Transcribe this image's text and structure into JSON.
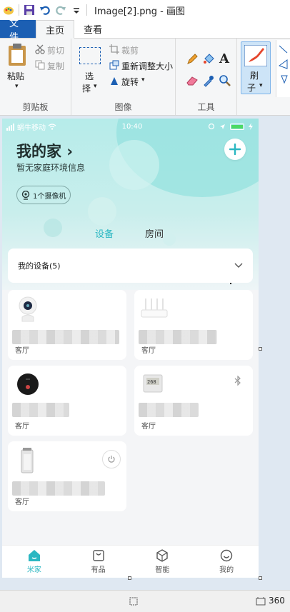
{
  "window": {
    "title": "Image[2].png - 画图"
  },
  "ribbon_tabs": {
    "file": "文件",
    "home": "主页",
    "view": "查看"
  },
  "ribbon": {
    "clipboard": {
      "paste": "粘贴",
      "cut": "剪切",
      "copy": "复制",
      "label": "剪贴板"
    },
    "image": {
      "select_1": "选",
      "select_2": "择",
      "crop": "裁剪",
      "resize": "重新调整大小",
      "rotate": "旋转",
      "label": "图像"
    },
    "tools": {
      "label": "工具"
    },
    "brushes": {
      "label_1": "刷",
      "label_2": "子"
    }
  },
  "phone": {
    "status": {
      "carrier": "蜗牛移动",
      "time": "10:40"
    },
    "home_title": "我的家",
    "home_title_arrow": "›",
    "home_subtitle": "暂无家庭环境信息",
    "camera_chip": "1个摄像机",
    "segments": {
      "devices": "设备",
      "rooms": "房间"
    },
    "devices_header": "我的设备(5)",
    "devices": [
      {
        "room": "客厅",
        "icon": "camera-icon"
      },
      {
        "room": "客厅",
        "icon": "router-icon"
      },
      {
        "room": "客厅",
        "icon": "door-lock-icon"
      },
      {
        "room": "客厅",
        "icon": "thermometer-display-icon",
        "extra_icon": "bluetooth-icon"
      },
      {
        "room": "客厅",
        "icon": "air-purifier-icon",
        "extra_icon": "power-icon"
      }
    ],
    "tabbar": [
      {
        "label": "米家",
        "active": true
      },
      {
        "label": "有品",
        "active": false
      },
      {
        "label": "智能",
        "active": false
      },
      {
        "label": "我的",
        "active": false
      }
    ]
  },
  "statusbar": {
    "dimensions": "360"
  },
  "colors": {
    "accent": "#2bb7c2",
    "ribbon_file": "#1c5fb3",
    "header_teal": "#b6ecea"
  }
}
